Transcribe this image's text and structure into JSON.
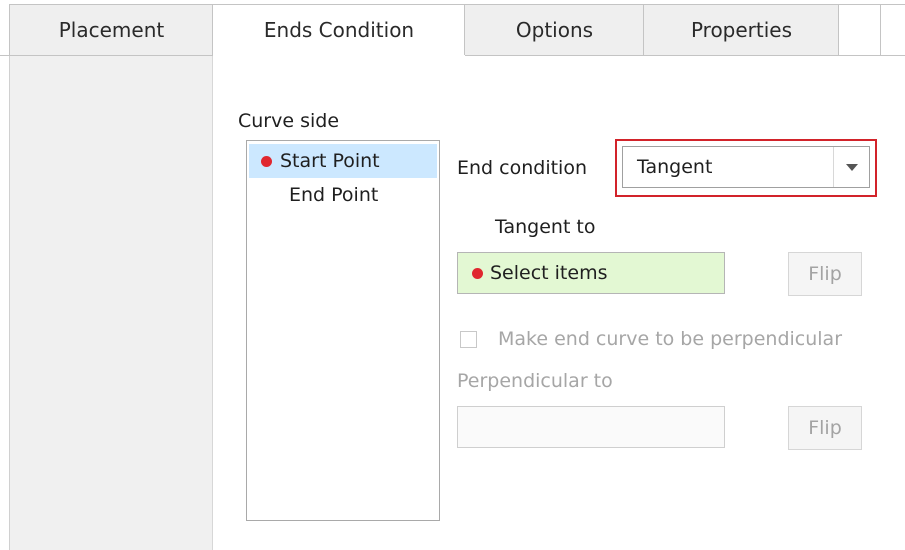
{
  "tabs": [
    {
      "label": "Placement",
      "active": false
    },
    {
      "label": "Ends Condition",
      "active": true
    },
    {
      "label": "Options",
      "active": false
    },
    {
      "label": "Properties",
      "active": false
    }
  ],
  "curve_side": {
    "label": "Curve side",
    "items": [
      {
        "label": "Start Point",
        "selected": true,
        "icon": "red-dot"
      },
      {
        "label": "End Point",
        "selected": false
      }
    ]
  },
  "end_condition": {
    "label": "End condition",
    "value": "Tangent"
  },
  "tangent_to": {
    "label": "Tangent to",
    "collector_text": "Select items",
    "flip_label": "Flip"
  },
  "perpendicular": {
    "checkbox_label": "Make end curve to be perpendicular",
    "checked": false,
    "label": "Perpendicular to",
    "collector_text": "",
    "flip_label": "Flip"
  },
  "colors": {
    "highlight_frame": "#d2232a",
    "active_collector": "#e3f8d3",
    "selection": "#cce8ff",
    "required_dot": "#e0272f"
  }
}
